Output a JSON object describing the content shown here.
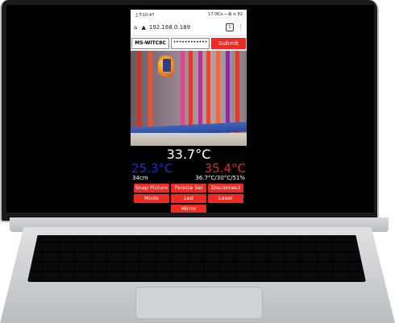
{
  "status_bar": {
    "time": "上午10:47",
    "indicators": "17.0K/s ⌁ ⚅ ≋ 82"
  },
  "browser": {
    "url": "192.168.0.189",
    "tab_count": "1"
  },
  "form": {
    "ssid": "MS-WITC8C",
    "password_mask": "••••••••••••",
    "submit_label": "Submit"
  },
  "readings": {
    "center_temp": "33.7°C",
    "min_temp": "25.3°C",
    "max_temp": "35.4°C",
    "distance": "34cm",
    "environment": "36.7°C/30°C/51%"
  },
  "buttons": {
    "snap": "Snap Picture",
    "palette": "Palette Sel",
    "disconnect": "Disconnect",
    "mode": "Mode",
    "led": "Led",
    "laser": "Laser",
    "mirror": "Mirror"
  },
  "colors": {
    "accent": "#ee2b23",
    "min_temp": "#1f2bd6",
    "max_temp": "#e0261f"
  }
}
